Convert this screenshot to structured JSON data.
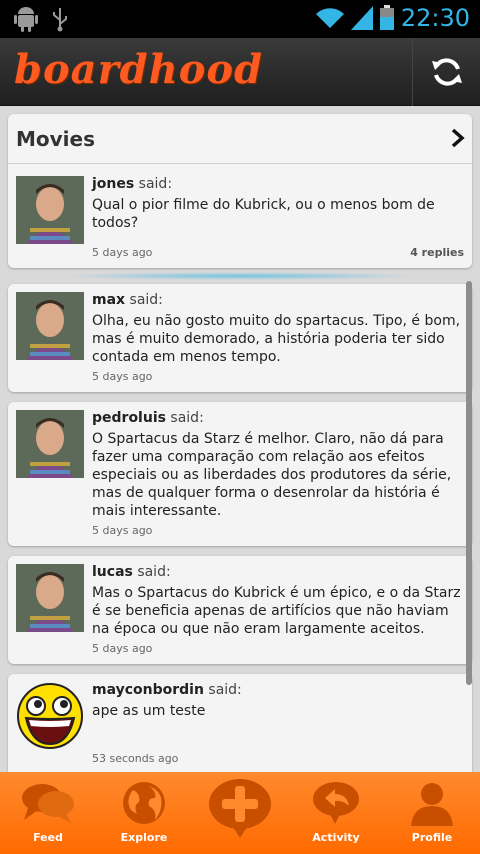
{
  "status": {
    "time": "22:30"
  },
  "app": {
    "logo": "boardhood"
  },
  "board": {
    "title": "Movies"
  },
  "posts": [
    {
      "author": "jones",
      "said": "said:",
      "text": "Qual o pior filme do Kubrick, ou o menos bom de todos?",
      "time": "5 days ago",
      "replies": "4 replies"
    },
    {
      "author": "max",
      "said": "said:",
      "text": "Olha, eu não gosto muito do spartacus. Tipo, é bom, mas é muito demorado, a história poderia ter sido contada em menos tempo.",
      "time": "5 days ago"
    },
    {
      "author": "pedroluis",
      "said": "said:",
      "text": "O Spartacus da Starz é melhor. Claro, não dá para fazer uma comparação com relação aos efeitos especiais ou as liberdades dos produtores da série, mas de qualquer forma o desenrolar da história é mais interessante.",
      "time": "5 days ago"
    },
    {
      "author": "lucas",
      "said": "said:",
      "text": "Mas o Spartacus do Kubrick é um épico, e o da Starz é se beneficia apenas de artifícios que não haviam na época ou que não eram largamente aceitos.",
      "time": "5 days ago"
    },
    {
      "author": "mayconbordin",
      "said": "said:",
      "text": "ape as um teste",
      "time": "53 seconds ago"
    }
  ],
  "nav": [
    {
      "label": "Feed",
      "icon": "chat-bubbles-icon"
    },
    {
      "label": "Explore",
      "icon": "globe-icon"
    },
    {
      "label": "",
      "icon": "plus-bubble-icon"
    },
    {
      "label": "Activity",
      "icon": "reply-bubble-icon"
    },
    {
      "label": "Profile",
      "icon": "person-icon"
    }
  ],
  "colors": {
    "accent": "#ff6a00",
    "status_blue": "#33b5e5",
    "logo": "#ff5a1f"
  }
}
